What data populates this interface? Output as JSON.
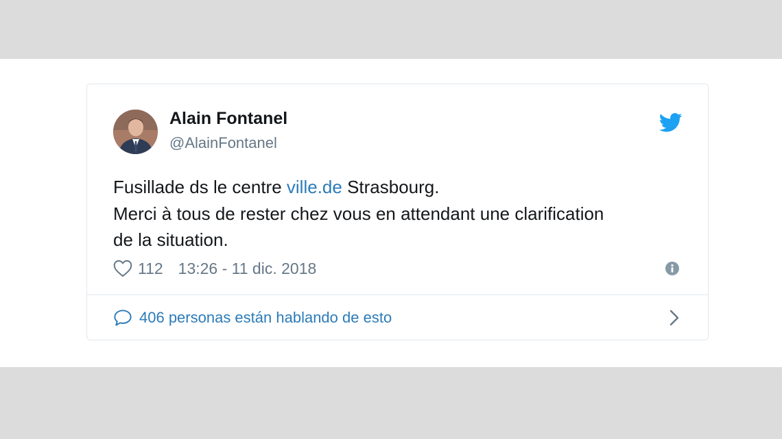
{
  "tweet": {
    "author_name": "Alain Fontanel",
    "author_handle": "@AlainFontanel",
    "text_line1_before": "Fusillade ds le centre ",
    "text_line1_link": "ville.de",
    "text_line1_after": " Strasbourg.",
    "text_line2": "Merci à tous de rester chez vous en attendant une clarification",
    "text_line3": "de la situation.",
    "like_count": "112",
    "timestamp": "13:26 - 11 dic. 2018",
    "conversation_label": "406 personas están hablando de esto"
  },
  "icons": {
    "twitter_logo": "twitter-bird-icon",
    "like": "heart-icon",
    "info": "info-icon",
    "reply": "speech-bubble-icon",
    "chevron": "chevron-right-icon"
  },
  "colors": {
    "link": "#2b7bb9",
    "twitter_blue": "#1da1f2",
    "text": "#14171a",
    "secondary_text": "#657786",
    "border": "#e1e8ed",
    "page_background": "#dcdcdc"
  }
}
